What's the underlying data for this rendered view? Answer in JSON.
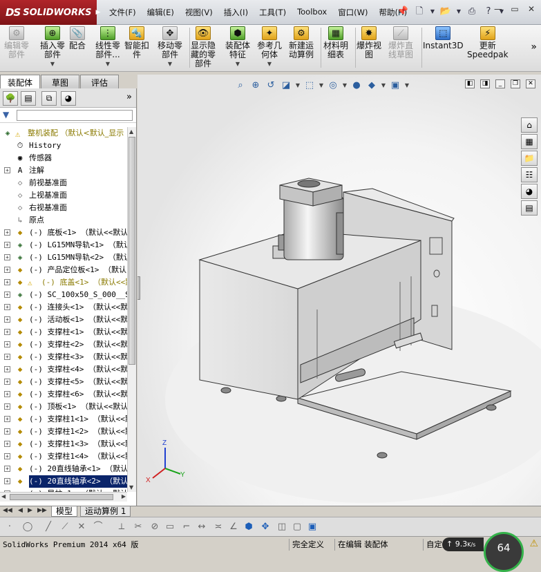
{
  "app": {
    "brand": "SOLIDWORKS",
    "brand_prefix": "DS",
    "menus": [
      "文件(F)",
      "编辑(E)",
      "视图(V)",
      "插入(I)",
      "工具(T)",
      "Toolbox",
      "窗口(W)",
      "帮助(H)"
    ],
    "title_tools": [
      "pin-icon",
      "new-document-icon",
      "open-icon",
      "print-icon",
      "help-icon"
    ],
    "window_buttons": [
      "minimize",
      "restore",
      "close"
    ]
  },
  "ribbon": [
    {
      "label_lines": [
        "编辑零",
        "部件"
      ],
      "icon": "edit-component-icon",
      "color": "grey",
      "disabled": true,
      "dropdown": false
    },
    {
      "label_lines": [
        "插入零",
        "部件"
      ],
      "icon": "insert-component-icon",
      "color": "green",
      "disabled": false,
      "dropdown": true
    },
    {
      "label_lines": [
        "配合",
        ""
      ],
      "icon": "mate-icon",
      "color": "grey",
      "disabled": false,
      "dropdown": false
    },
    {
      "label_lines": [
        "线性零",
        "部件..."
      ],
      "icon": "linear-pattern-icon",
      "color": "green",
      "disabled": false,
      "dropdown": true
    },
    {
      "label_lines": [
        "智能扣",
        "件"
      ],
      "icon": "smart-fasteners-icon",
      "color": "gold",
      "disabled": false,
      "dropdown": false
    },
    {
      "label_lines": [
        "移动零",
        "部件"
      ],
      "icon": "move-component-icon",
      "color": "grey",
      "disabled": false,
      "dropdown": true
    },
    {
      "label_lines": [
        "显示隐",
        "藏的零",
        "部件"
      ],
      "icon": "show-hidden-icon",
      "color": "gold",
      "disabled": false,
      "dropdown": false
    },
    {
      "label_lines": [
        "装配体",
        "特征"
      ],
      "icon": "assembly-features-icon",
      "color": "green",
      "disabled": false,
      "dropdown": true
    },
    {
      "label_lines": [
        "参考几",
        "何体"
      ],
      "icon": "reference-geometry-icon",
      "color": "gold",
      "disabled": false,
      "dropdown": true
    },
    {
      "label_lines": [
        "新建运",
        "动算例"
      ],
      "icon": "motion-study-icon",
      "color": "gold",
      "disabled": false,
      "dropdown": false
    },
    {
      "label_lines": [
        "材料明",
        "细表"
      ],
      "icon": "bom-icon",
      "color": "green",
      "disabled": false,
      "dropdown": false
    },
    {
      "label_lines": [
        "爆炸视",
        "图"
      ],
      "icon": "exploded-view-icon",
      "color": "gold",
      "disabled": false,
      "dropdown": false
    },
    {
      "label_lines": [
        "爆炸直",
        "线草图"
      ],
      "icon": "explode-line-sketch-icon",
      "color": "grey",
      "disabled": true,
      "dropdown": false
    },
    {
      "label_lines": [
        "Instant3D",
        ""
      ],
      "icon": "instant3d-icon",
      "color": "blue",
      "disabled": false,
      "dropdown": false
    },
    {
      "label_lines": [
        "更新",
        "Speedpak"
      ],
      "icon": "speedpak-icon",
      "color": "gold",
      "disabled": false,
      "dropdown": false
    }
  ],
  "ribbon_more": "»",
  "tabs": [
    "装配体",
    "草图",
    "评估"
  ],
  "active_tab": 0,
  "panel_more": "»",
  "tree": {
    "root": {
      "label": "整机装配 （默认<默认_显示"
    },
    "rows": [
      {
        "label": "History",
        "icon": "history-icon",
        "expand": false,
        "kind": "feature"
      },
      {
        "label": "传感器",
        "icon": "sensors-icon",
        "expand": false,
        "kind": "feature"
      },
      {
        "label": "注解",
        "icon": "annotations-icon",
        "expand": true,
        "kind": "feature"
      },
      {
        "label": "前视基准面",
        "icon": "plane-icon",
        "expand": false,
        "kind": "plane"
      },
      {
        "label": "上视基准面",
        "icon": "plane-icon",
        "expand": false,
        "kind": "plane"
      },
      {
        "label": "右视基准面",
        "icon": "plane-icon",
        "expand": false,
        "kind": "plane"
      },
      {
        "label": "原点",
        "icon": "origin-icon",
        "expand": false,
        "kind": "origin"
      },
      {
        "label": "(-) 底板<1> （默认<<默认",
        "icon": "part-icon",
        "expand": true,
        "kind": "part"
      },
      {
        "label": "(-) LG15MN导轨<1> （默认",
        "icon": "assembly-icon",
        "expand": true,
        "kind": "asm"
      },
      {
        "label": "(-) LG15MN导轨<2> （默认",
        "icon": "assembly-icon",
        "expand": true,
        "kind": "asm"
      },
      {
        "label": "(-) 产品定位板<1> （默认",
        "icon": "part-icon",
        "expand": true,
        "kind": "part"
      },
      {
        "label": "(-) 底盖<1> （默认<<默",
        "icon": "part-icon",
        "expand": true,
        "kind": "part-warn"
      },
      {
        "label": "(-) SC_100x50_S_000__SC",
        "icon": "assembly-icon",
        "expand": true,
        "kind": "asm"
      },
      {
        "label": "(-) 连接头<1> （默认<<默",
        "icon": "part-icon",
        "expand": true,
        "kind": "part"
      },
      {
        "label": "(-) 活动板<1> （默认<<默",
        "icon": "part-icon",
        "expand": true,
        "kind": "part"
      },
      {
        "label": "(-) 支撑柱<1> （默认<<默",
        "icon": "part-icon",
        "expand": true,
        "kind": "part"
      },
      {
        "label": "(-) 支撑柱<2> （默认<<默",
        "icon": "part-icon",
        "expand": true,
        "kind": "part"
      },
      {
        "label": "(-) 支撑柱<3> （默认<<默",
        "icon": "part-icon",
        "expand": true,
        "kind": "part"
      },
      {
        "label": "(-) 支撑柱<4> （默认<<默",
        "icon": "part-icon",
        "expand": true,
        "kind": "part"
      },
      {
        "label": "(-) 支撑柱<5> （默认<<默",
        "icon": "part-icon",
        "expand": true,
        "kind": "part"
      },
      {
        "label": "(-) 支撑柱<6> （默认<<默",
        "icon": "part-icon",
        "expand": true,
        "kind": "part"
      },
      {
        "label": "(-) 顶板<1> （默认<<默认",
        "icon": "part-icon",
        "expand": true,
        "kind": "part"
      },
      {
        "label": "(-) 支撑柱1<1> （默认<<默",
        "icon": "part-icon",
        "expand": true,
        "kind": "part"
      },
      {
        "label": "(-) 支撑柱1<2> （默认<<默",
        "icon": "part-icon",
        "expand": true,
        "kind": "part"
      },
      {
        "label": "(-) 支撑柱1<3> （默认<<默",
        "icon": "part-icon",
        "expand": true,
        "kind": "part"
      },
      {
        "label": "(-) 支撑柱1<4> （默认<<默",
        "icon": "part-icon",
        "expand": true,
        "kind": "part"
      },
      {
        "label": "(-) 20直线轴承<1> （默认",
        "icon": "part-icon",
        "expand": true,
        "kind": "part"
      },
      {
        "label": "(-) 20直线轴承<2> （默认",
        "icon": "part-icon",
        "expand": true,
        "kind": "part",
        "selected": true
      },
      {
        "label": "(-) 导柱<1> （默认<<默认",
        "icon": "part-icon",
        "expand": true,
        "kind": "part"
      }
    ]
  },
  "bottom_tabs": [
    "模型",
    "运动算例 1"
  ],
  "active_bottom_tab": 0,
  "status": {
    "version": "SolidWorks Premium 2014 x64 版",
    "state": "完全定义",
    "mode": "在编辑 装配体",
    "custom": "自定义",
    "speed": "9.3",
    "speed_unit": "K/s",
    "gauge": "64"
  },
  "triad": {
    "x": "X",
    "y": "Y",
    "z": "Z"
  },
  "colors": {
    "brand": "#9e1b1f",
    "selected": "#0a246a",
    "warning": "#d4a700",
    "gauge_ring": "#34b24a"
  }
}
